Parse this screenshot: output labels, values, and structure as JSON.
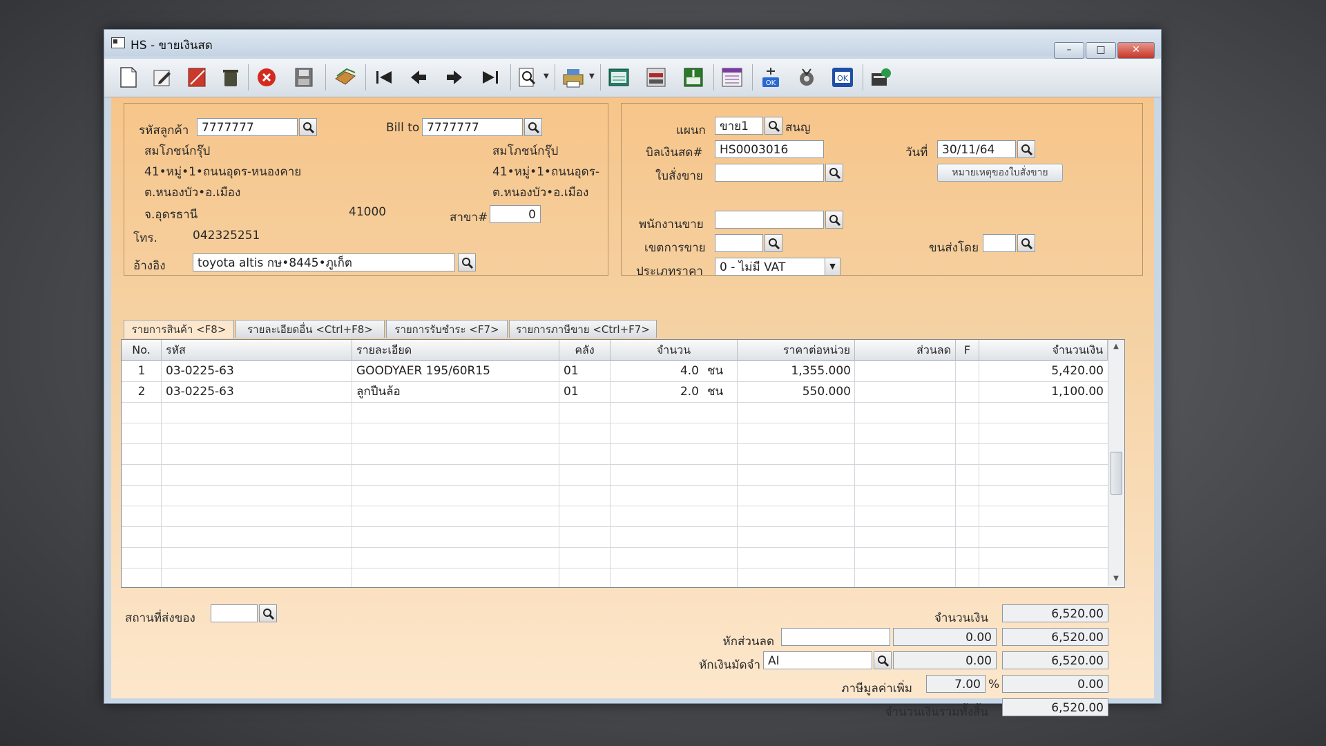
{
  "window": {
    "title": "HS - ขายเงินสด",
    "controls": {
      "minimize": "–",
      "maximize": "□",
      "close": "✕"
    }
  },
  "toolbar": {
    "icons": [
      "new-icon",
      "edit-icon",
      "void-icon",
      "delete-icon",
      "cancel-icon",
      "save-icon",
      "copy-icon",
      "first-record-icon",
      "previous-record-icon",
      "next-record-icon",
      "last-record-icon",
      "find-icon",
      "print-icon",
      "report-icon",
      "export-icon",
      "import-icon",
      "calendar-icon",
      "approve-icon",
      "tools-icon",
      "confirm-icon",
      "user-icon"
    ]
  },
  "customer": {
    "code_label": "รหัสลูกค้า",
    "code": "7777777",
    "billto_label": "Bill to",
    "billto": "7777777",
    "name": "สมโภชน์กรุ๊ป",
    "address1": "41•หมู่•1•ถนนอุดร-หนองคาย",
    "address2": "ต.หนองบัว•อ.เมือง",
    "province": "จ.อุดรธานี",
    "postcode": "41000",
    "billto_name": "สมโภชน์กรุ๊ป",
    "billto_address1": "41•หมู่•1•ถนนอุดร-",
    "billto_address2": "ต.หนองบัว•อ.เมือง",
    "branch_label": "สาขา#",
    "branch": "0",
    "phone_label": "โทร.",
    "phone": "042325251",
    "ref_label": "อ้างอิง",
    "ref": "toyota altis กษ•8445•ภูเก็ต"
  },
  "document": {
    "dept_label": "แผนก",
    "dept": "ขาย1",
    "dept_name": "สนญ",
    "bill_label": "บิลเงินสด#",
    "bill_no": "HS0003016",
    "date_label": "วันที่",
    "date": "30/11/64",
    "so_label": "ใบสั่งขาย",
    "so": "",
    "note_button": "หมายเหตุของใบสั่งขาย",
    "salesman_label": "พนักงานขาย",
    "salesman": "",
    "area_label": "เขตการขาย",
    "area": "",
    "ship_label": "ขนส่งโดย",
    "ship": "",
    "price_type_label": "ประเภทราคา",
    "price_type": "0 - ไม่มี VAT"
  },
  "tabs": [
    {
      "label": "รายการสินค้า <F8>"
    },
    {
      "label": "รายละเอียดอื่น <Ctrl+F8>"
    },
    {
      "label": "รายการรับชำระ <F7>"
    },
    {
      "label": "รายการภาษีขาย <Ctrl+F7>"
    }
  ],
  "grid": {
    "headers": {
      "no": "No.",
      "code": "รหัส",
      "desc": "รายละเอียด",
      "wh": "คลัง",
      "qty": "จำนวน",
      "price": "ราคาต่อหน่วย",
      "disc": "ส่วนลด",
      "f": "F",
      "amount": "จำนวนเงิน"
    },
    "rows": [
      {
        "no": "1",
        "code": "03-0225-63",
        "desc": "GOODYAER 195/60R15",
        "wh": "01",
        "qty": "4.0",
        "unit": "ชน",
        "price": "1,355.000",
        "disc": "",
        "f": "",
        "amount": "5,420.00"
      },
      {
        "no": "2",
        "code": "03-0225-63",
        "desc": "ลูกปืนล้อ",
        "wh": "01",
        "qty": "2.0",
        "unit": "ชน",
        "price": "550.000",
        "disc": "",
        "f": "",
        "amount": "1,100.00"
      }
    ]
  },
  "footer": {
    "location_label": "สถานที่ส่งของ",
    "location": "",
    "amount_label": "จำนวนเงิน",
    "amount": "6,520.00",
    "discount_label": "หักส่วนลด",
    "discount_text": "",
    "discount_value": "0.00",
    "after_discount": "6,520.00",
    "deposit_label": "หักเงินมัดจำ",
    "deposit_code": "AI",
    "deposit_value": "0.00",
    "after_deposit": "6,520.00",
    "vat_label": "ภาษีมูลค่าเพิ่ม",
    "vat_rate": "7.00",
    "vat_pct": "%",
    "vat_value": "0.00",
    "total_label": "จำนวนเงินรวมทั้งสิ้น",
    "total": "6,520.00"
  }
}
